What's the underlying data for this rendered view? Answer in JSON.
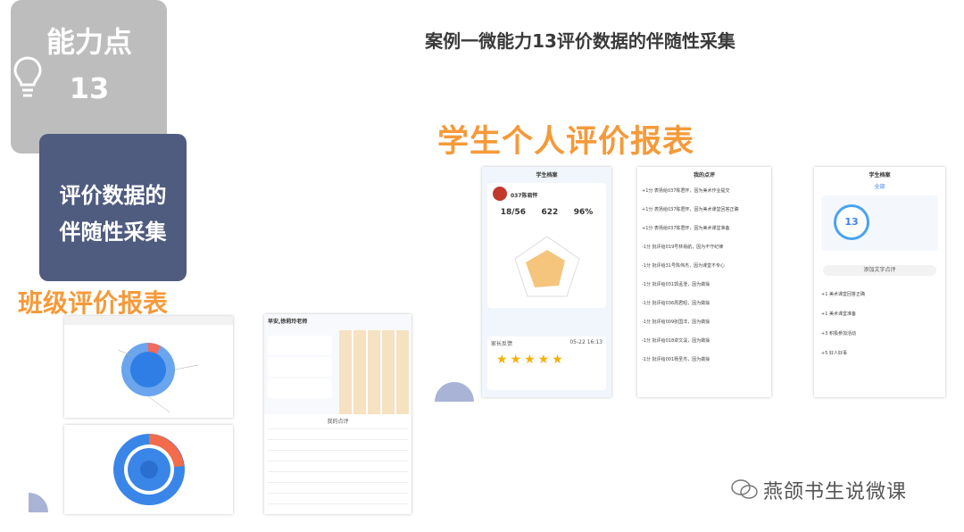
{
  "badge": {
    "title": "能力点",
    "number": "13",
    "icon": "lightbulb-icon"
  },
  "section": {
    "line1": "评价数据的",
    "line2": "伴随性采集"
  },
  "title": "案例一微能力13评价数据的伴随性采集",
  "class_report_title": "班级评价报表",
  "student_report_title": "学生个人评价报表",
  "profile": {
    "header": "学生档案",
    "name": "037陈君怀",
    "stats": [
      "18/56",
      "622",
      "96%"
    ],
    "parent_feedback": "家长反馈",
    "feedback_time": "05-22 16:13"
  },
  "comments": {
    "header": "我的点评",
    "items": [
      "+1分 表扬给037陈君怀，因为美术作业提交",
      "+1分 表扬给037陈君怀，因为美术课堂回答正确",
      "+1分 表扬给037陈君怀，因为美术课堂准备",
      "-1分 批评给019号林易航，因为不守纪律",
      "-1分 批评给31号陈伟杰，因为课堂不专心",
      "-1分 批评给031郭孟澄，因为做操",
      "-1分 批评给036周君昭，因为做操",
      "-1分 批评给009张国洋，因为做操",
      "-1分 批评给018卓文淏，因为做操",
      "-1分 批评给001杨圣杰，因为做操"
    ]
  },
  "profile2": {
    "header": "学生档案",
    "tab": "全部",
    "score": "13",
    "add_btn": "添加文字点评",
    "entries": [
      "+1 美术课堂回答正确",
      "+1 美术课堂准备",
      "+3 积极参加活动",
      "+5 好人好事"
    ]
  },
  "teacher_app": {
    "greeting": "早安,徐莉玲老师"
  },
  "watermark": "燕颌书生说微课"
}
